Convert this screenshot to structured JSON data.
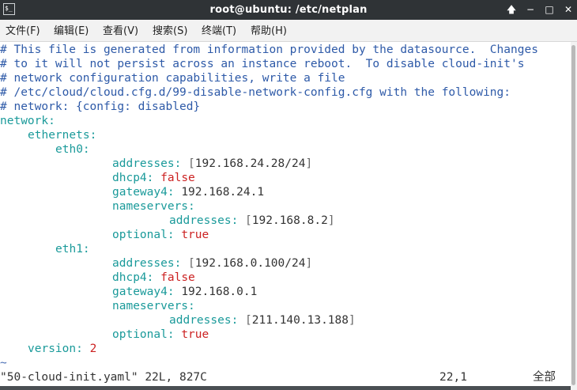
{
  "window": {
    "title": "root@ubuntu: /etc/netplan",
    "terminal_icon": "$_",
    "buttons": {
      "up": "🡅",
      "minimize": "−",
      "maximize": "□",
      "close": "✕"
    }
  },
  "menu": [
    "文件(F)",
    "编辑(E)",
    "查看(V)",
    "搜索(S)",
    "终端(T)",
    "帮助(H)"
  ],
  "file": {
    "comments": [
      "# This file is generated from information provided by the datasource.  Changes",
      "# to it will not persist across an instance reboot.  To disable cloud-init's",
      "# network configuration capabilities, write a file",
      "# /etc/cloud/cloud.cfg.d/99-disable-network-config.cfg with the following:",
      "# network: {config: disabled}"
    ],
    "network_key": "network",
    "ethernets_key": "ethernets",
    "interfaces": [
      {
        "name": "eth0",
        "addresses": "192.168.24.28/24",
        "dhcp4": "false",
        "gateway4": "192.168.24.1",
        "nameserver_addresses": "192.168.8.2",
        "optional": "true"
      },
      {
        "name": "eth1",
        "addresses": "192.168.0.100/24",
        "dhcp4": "false",
        "gateway4": "192.168.0.1",
        "nameserver_addresses": "211.140.13.188",
        "optional": "true"
      }
    ],
    "keys": {
      "addresses": "addresses",
      "dhcp4": "dhcp4",
      "gateway4": "gateway4",
      "nameservers": "nameservers",
      "optional": "optional",
      "version": "version"
    },
    "version": "2",
    "tilde": "~"
  },
  "status_bar": {
    "file_info": "\"50-cloud-init.yaml\" 22L, 827C",
    "cursor": "22,1",
    "position": "全部"
  }
}
